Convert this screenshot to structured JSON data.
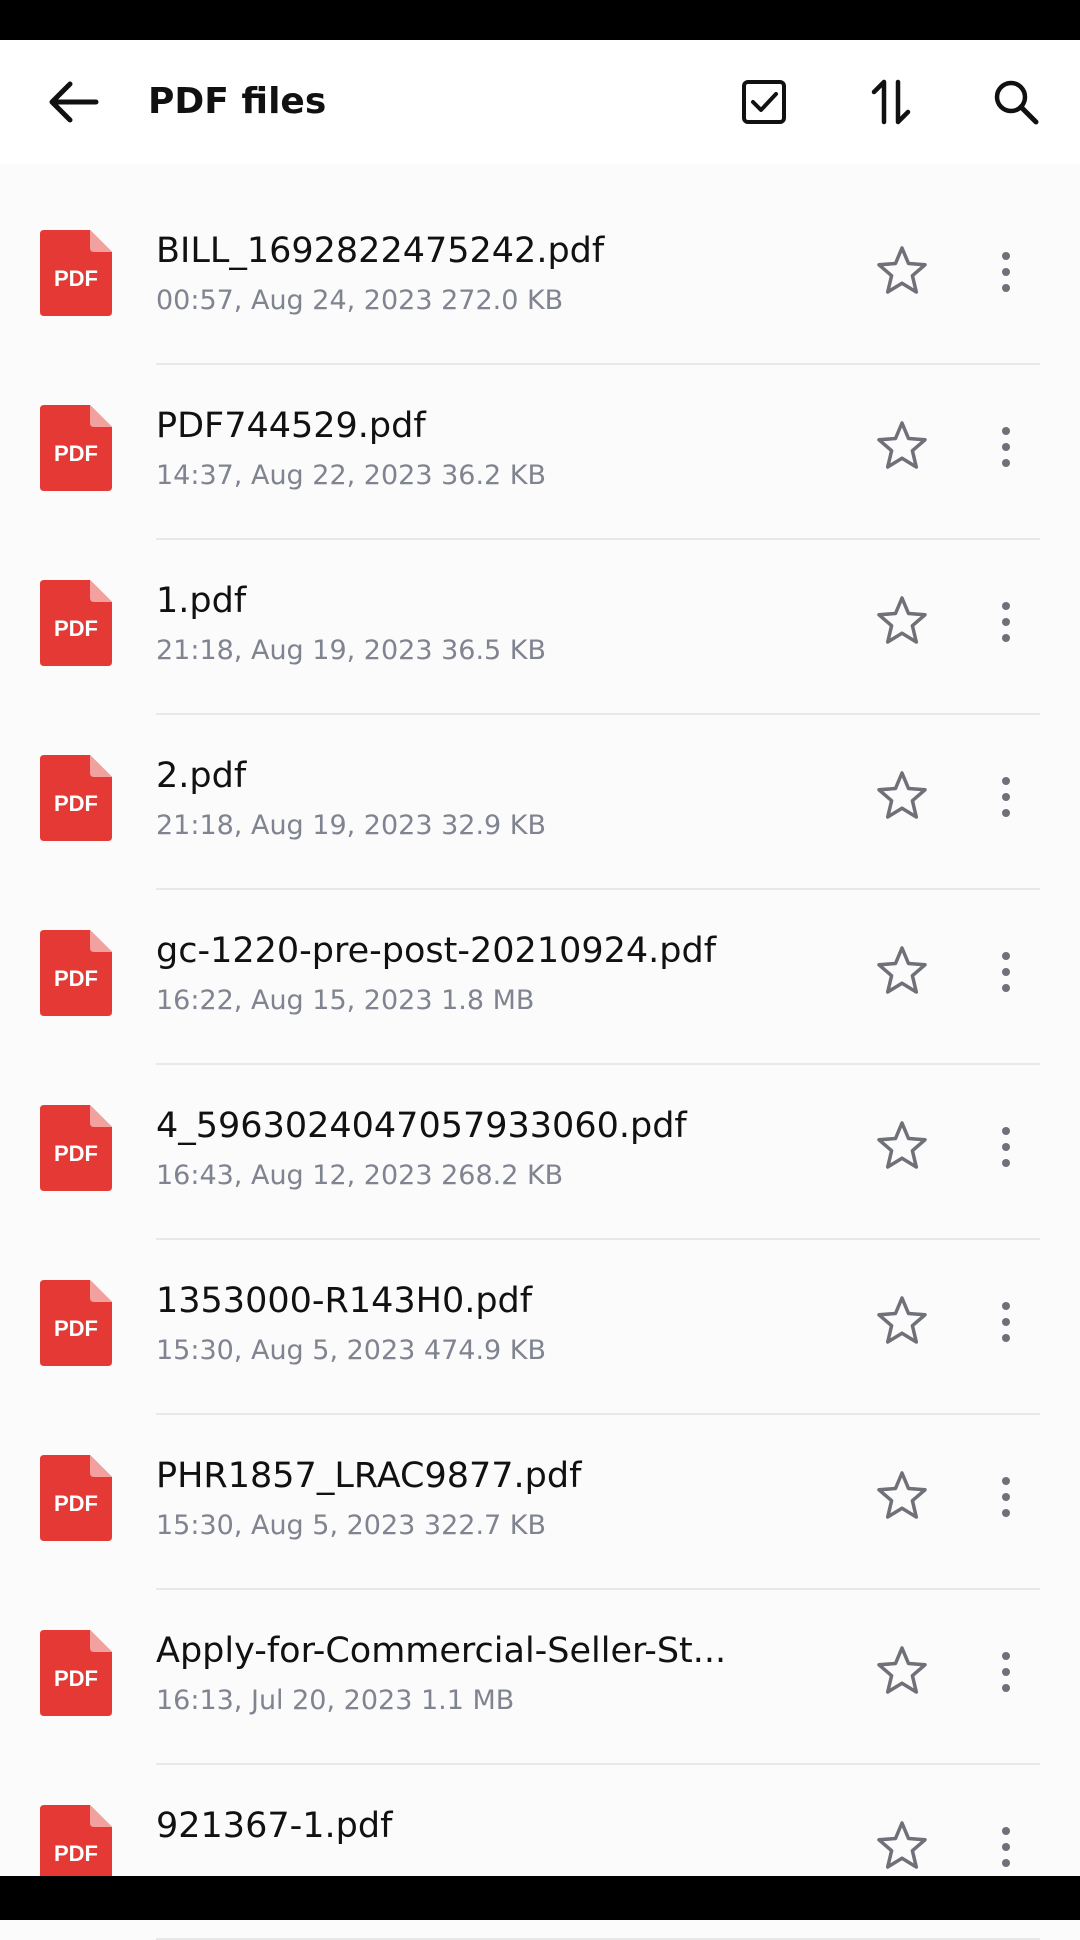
{
  "header": {
    "title": "PDF files",
    "back_icon": "arrow-left-icon",
    "select_icon": "checkbox-icon",
    "sort_icon": "sort-icon",
    "search_icon": "search-icon"
  },
  "colors": {
    "pdf_red": "#e53935",
    "meta_gray": "#808490"
  },
  "files": [
    {
      "name": "BILL_1692822475242.pdf",
      "meta": "00:57, Aug 24, 2023 272.0 KB",
      "icon_label": "PDF"
    },
    {
      "name": "PDF744529.pdf",
      "meta": "14:37, Aug 22, 2023 36.2 KB",
      "icon_label": "PDF"
    },
    {
      "name": "1.pdf",
      "meta": "21:18, Aug 19, 2023 36.5 KB",
      "icon_label": "PDF"
    },
    {
      "name": "2.pdf",
      "meta": "21:18, Aug 19, 2023 32.9 KB",
      "icon_label": "PDF"
    },
    {
      "name": "gc-1220-pre-post-20210924.pdf",
      "meta": "16:22, Aug 15, 2023 1.8 MB",
      "icon_label": "PDF"
    },
    {
      "name": "4_5963024047057933060.pdf",
      "meta": "16:43, Aug 12, 2023 268.2 KB",
      "icon_label": "PDF"
    },
    {
      "name": "1353000-R143H0.pdf",
      "meta": "15:30, Aug 5, 2023 474.9 KB",
      "icon_label": "PDF"
    },
    {
      "name": "PHR1857_LRAC9877.pdf",
      "meta": "15:30, Aug 5, 2023 322.7 KB",
      "icon_label": "PDF"
    },
    {
      "name": "Apply-for-Commercial-Seller-St...",
      "meta": "16:13, Jul 20, 2023 1.1 MB",
      "icon_label": "PDF"
    },
    {
      "name": "921367-1.pdf",
      "meta": "",
      "icon_label": "PDF"
    }
  ]
}
